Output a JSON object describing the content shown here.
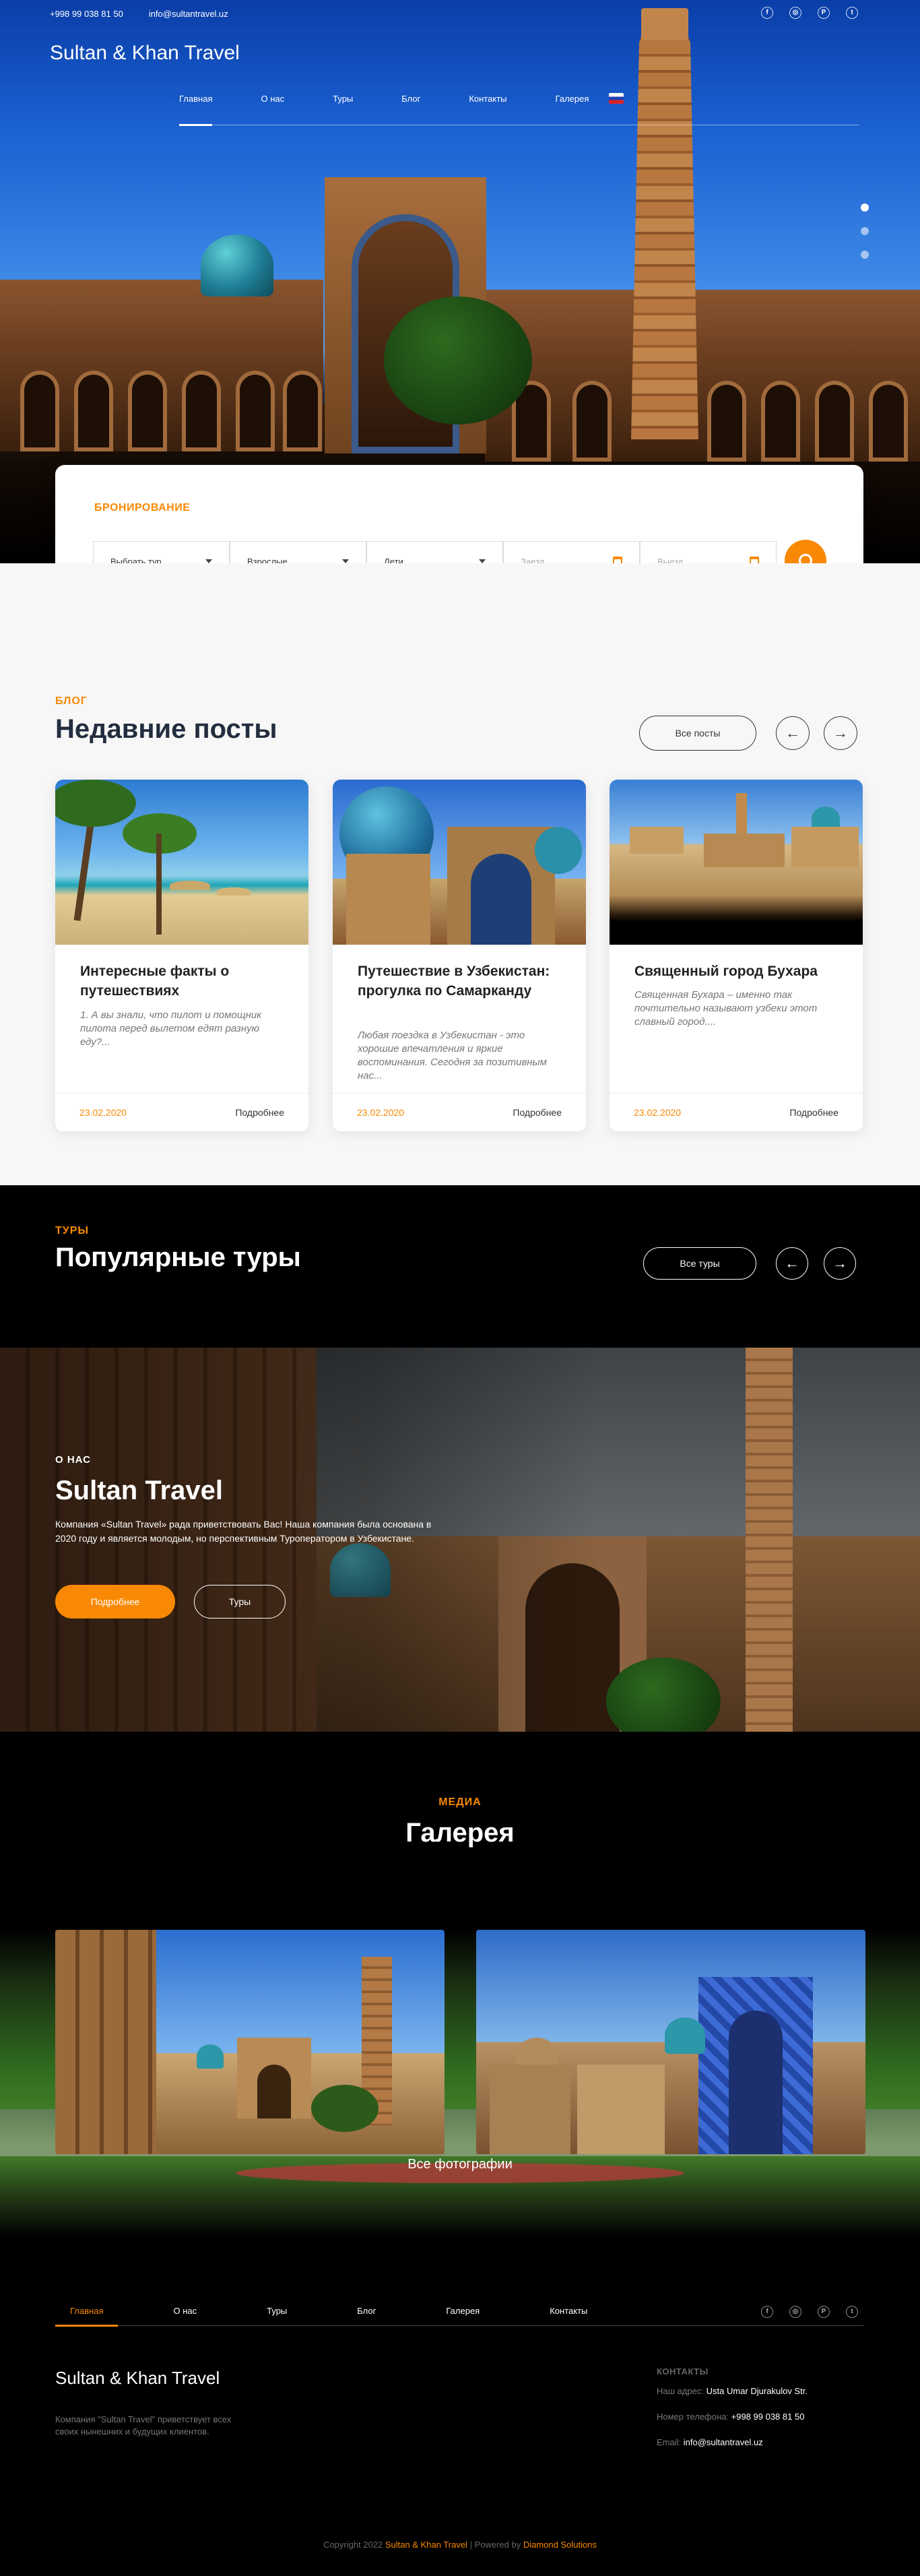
{
  "colors": {
    "accent": "#f98904",
    "dark": "#000000",
    "light_bg": "#f7f7f7"
  },
  "topbar": {
    "phone": "+998 99 038 81 50",
    "email": "info@sultantravel.uz"
  },
  "socials": [
    {
      "icon": "facebook-icon",
      "glyph": "f"
    },
    {
      "icon": "instagram-icon",
      "glyph": "◎"
    },
    {
      "icon": "pinterest-icon",
      "glyph": "P"
    },
    {
      "icon": "twitter-icon",
      "glyph": "t"
    }
  ],
  "brand": "Sultan & Khan Travel",
  "nav": {
    "items": [
      "Главная",
      "О нас",
      "Туры",
      "Блог",
      "Контакты",
      "Галерея"
    ],
    "active": "Главная",
    "language_icon": "russia-flag-icon"
  },
  "slider": {
    "slides": 3,
    "active": 1
  },
  "booking": {
    "title": "БРОНИРОВАНИЕ",
    "tour_select": "Выбрать тур",
    "adults_select": "Взрослые",
    "children_select": "Дети",
    "checkin_placeholder": "Заезд",
    "checkout_placeholder": "Выезд",
    "search_icon": "search-icon",
    "calendar_icon": "calendar-icon"
  },
  "blog": {
    "eyebrow": "БЛОГ",
    "title": "Недавние посты",
    "all_button": "Все посты",
    "posts": [
      {
        "title": "Интересные факты о путешествиях",
        "excerpt": "1. А вы знали, что пилот и помощник пилота перед вылетом едят разную еду?...",
        "date": "23.02.2020",
        "more": "Подробнее"
      },
      {
        "title": "Путешествие в Узбекистан: прогулка по Самарканду",
        "excerpt": "Любая поездка в Узбекистан - это хорошие впечатления и яркие воспоминания. Сегодня за позитивным нас...",
        "date": "23.02.2020",
        "more": "Подробнее"
      },
      {
        "title": "Священный город Бухара",
        "excerpt": "Священная Бухара – именно так почтительно называют узбеки этот славный город....",
        "date": "23.02.2020",
        "more": "Подробнее"
      }
    ]
  },
  "tours": {
    "eyebrow": "ТУРЫ",
    "title": "Популярные туры",
    "all_button": "Все туры"
  },
  "about": {
    "eyebrow": "О НАС",
    "title": "Sultan Travel",
    "text": "Компания «Sultan Travel» рада приветствовать Вас! Наша компания была основана в 2020 году и является молодым, но перспективным Туроператором в Узбекистане.",
    "more_button": "Подробнее",
    "tours_button": "Туры"
  },
  "gallery": {
    "eyebrow": "МЕДИА",
    "title": "Галерея",
    "all_button": "Все фотографии"
  },
  "footer": {
    "nav": [
      "Главная",
      "О нас",
      "Туры",
      "Блог",
      "Галерея",
      "Контакты"
    ],
    "brand": "Sultan & Khan Travel",
    "description": "Компания \"Sultan Travel\" приветствует всех своих нынешних и будущих клиентов.",
    "contacts_title": "КОНТАКТЫ",
    "address_label": "Наш адрес:",
    "address_value": "Usta Umar Djurakulov Str.",
    "phone_label": "Номер телефона:",
    "phone_value": "+998 99 038 81 50",
    "email_label": "Email:",
    "email_value": "info@sultantravel.uz",
    "copyright_prefix": "Copyright 2022",
    "copyright_brand": "Sultan & Khan Travel",
    "powered_prefix": "| Powered by",
    "powered_by": "Diamond Solutions"
  }
}
